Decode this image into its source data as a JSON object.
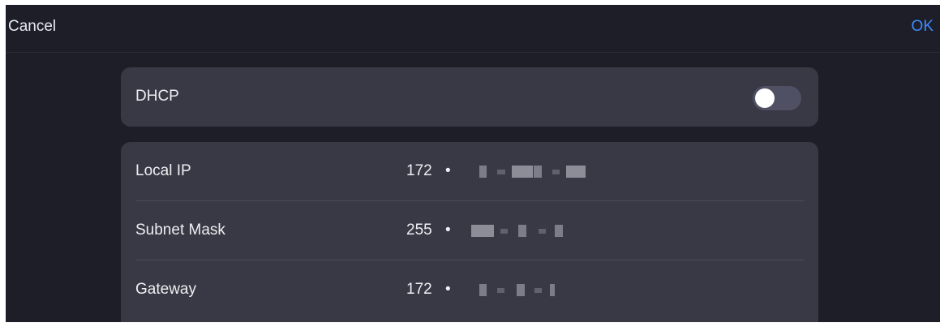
{
  "header": {
    "cancel_label": "Cancel",
    "ok_label": "OK"
  },
  "dhcp": {
    "label": "DHCP",
    "enabled": false
  },
  "network": {
    "rows": [
      {
        "label": "Local IP",
        "first_octet": "172",
        "separator": "•"
      },
      {
        "label": "Subnet Mask",
        "first_octet": "255",
        "separator": "•"
      },
      {
        "label": "Gateway",
        "first_octet": "172",
        "separator": "•"
      }
    ]
  },
  "colors": {
    "background": "#1d1e28",
    "card": "#383944",
    "accent": "#3d8bfd",
    "text": "#eeeef3"
  }
}
